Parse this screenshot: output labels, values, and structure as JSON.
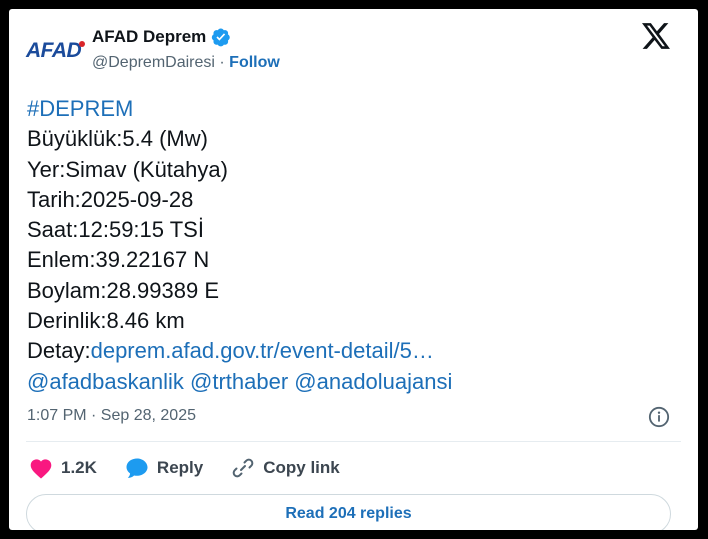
{
  "author": {
    "logo_text": "AFAD",
    "name": "AFAD Deprem",
    "handle": "@DepremDairesi",
    "separator": "·",
    "follow_label": "Follow",
    "verified_icon": "verified-badge-icon"
  },
  "tweet": {
    "hashtag": "#DEPREM",
    "lines": [
      "Büyüklük:5.4 (Mw)",
      "Yer:Simav (Kütahya)",
      "Tarih:2025-09-28",
      "Saat:12:59:15 TSİ",
      "Enlem:39.22167 N",
      "Boylam:28.99389 E",
      "Derinlik:8.46 km"
    ],
    "detail_label": "Detay:",
    "detail_link": "deprem.afad.gov.tr/event-detail/5…",
    "mentions": [
      "@afadbaskanlik",
      "@trthaber",
      "@anadoluajansi"
    ],
    "timestamp": "1:07 PM · Sep 28, 2025"
  },
  "actions": {
    "like_count": "1.2K",
    "reply_label": "Reply",
    "copy_label": "Copy link"
  },
  "read_replies_label": "Read 204 replies",
  "colors": {
    "link": "#1d6fb8",
    "like": "#f91880",
    "reply": "#1d9bf0",
    "verified": "#1d9bf0",
    "brand": "#1b4b9b"
  }
}
